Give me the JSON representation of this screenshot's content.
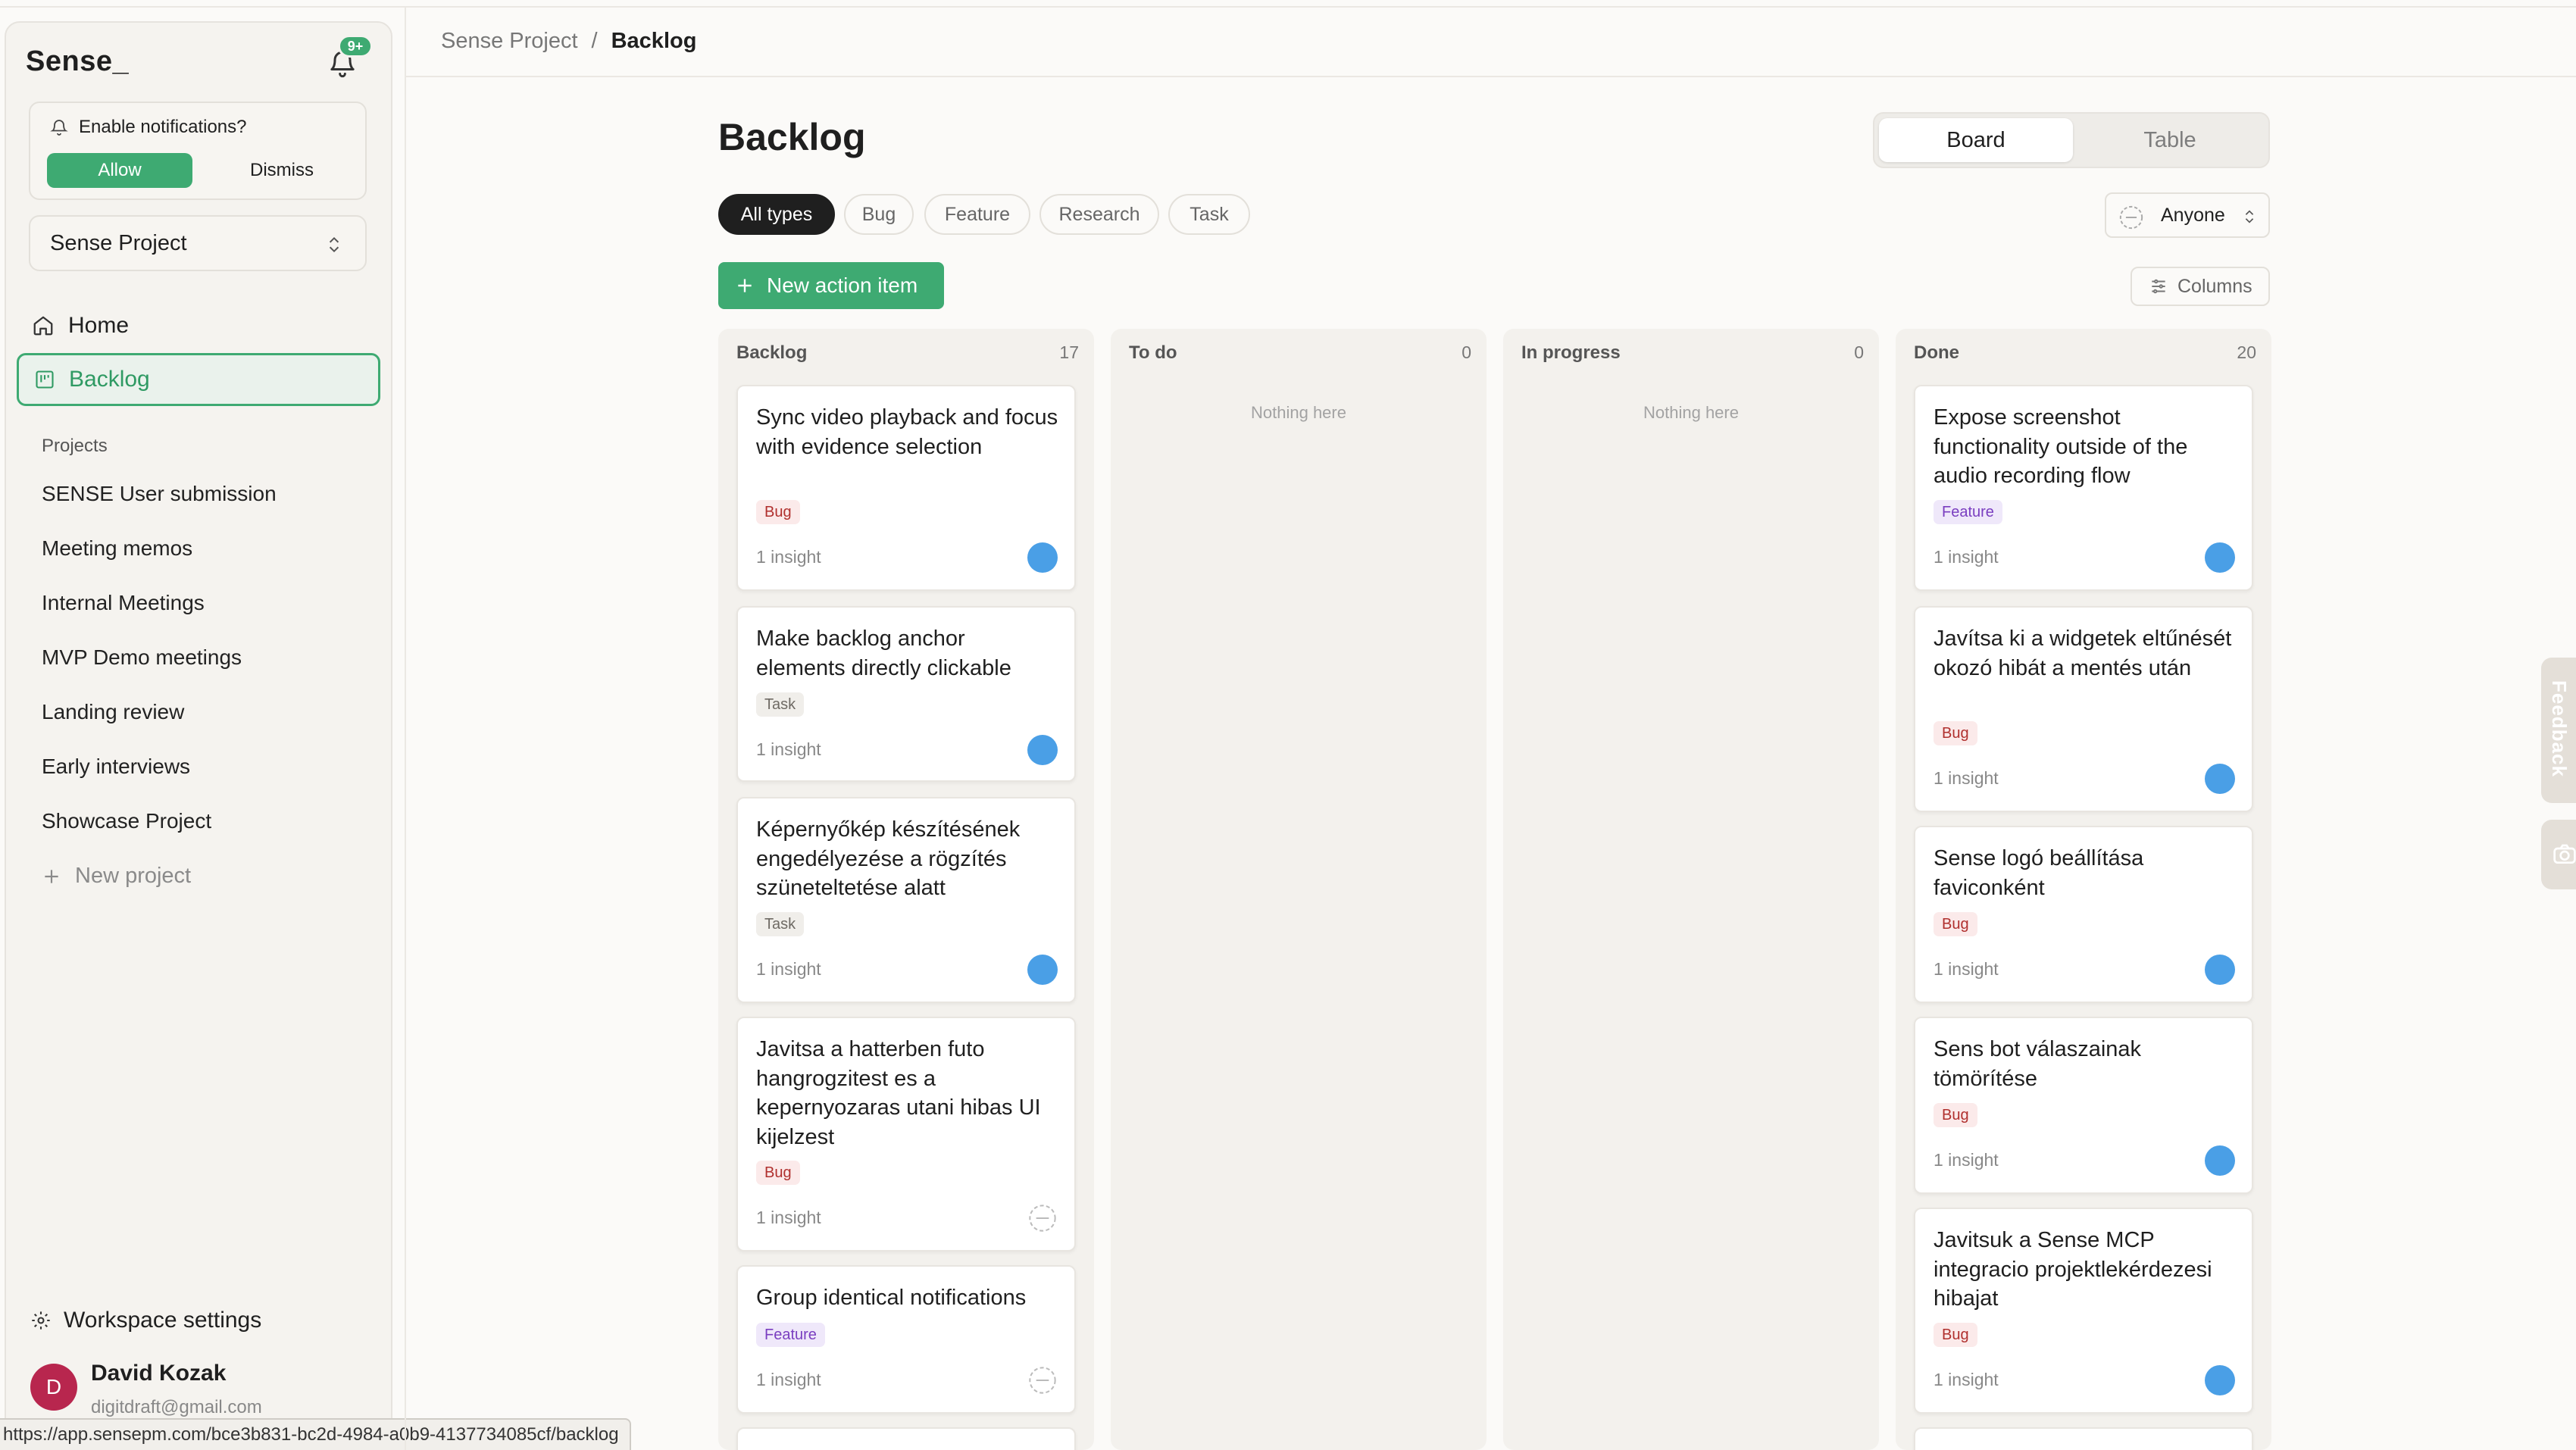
{
  "brand": "Sense_",
  "notifications": {
    "badge": "9+",
    "prompt": "Enable notifications?",
    "allow": "Allow",
    "dismiss": "Dismiss"
  },
  "project_selector": {
    "value": "Sense Project"
  },
  "nav": {
    "home": "Home",
    "backlog": "Backlog"
  },
  "projects": {
    "label": "Projects",
    "items": [
      "SENSE User submission",
      "Meeting memos",
      "Internal Meetings",
      "MVP Demo meetings",
      "Landing review",
      "Early interviews",
      "Showcase Project"
    ],
    "new_project": "New project"
  },
  "workspace_settings": "Workspace settings",
  "user": {
    "initial": "D",
    "name": "David Kozak",
    "email": "digitdraft@gmail.com"
  },
  "status_url": "https://app.sensepm.com/bce3b831-bc2d-4984-a0b9-4137734085cf/backlog",
  "breadcrumb": {
    "project": "Sense Project",
    "separator": "/",
    "current": "Backlog"
  },
  "page_title": "Backlog",
  "view_toggle": {
    "board": "Board",
    "table": "Table",
    "selected": "Board"
  },
  "type_filters": [
    "All types",
    "Bug",
    "Feature",
    "Research",
    "Task"
  ],
  "type_filter_selected": "All types",
  "assignee_filter": "Anyone",
  "new_action_item": "New action item",
  "columns_button": "Columns",
  "board": {
    "columns": [
      {
        "name": "Backlog",
        "count": "17",
        "cards": [
          {
            "title": "Sync video playback and focus with evidence selection",
            "tag": "Bug",
            "insights": "1 insight",
            "assigned": true
          },
          {
            "title": "Make backlog anchor elements directly clickable",
            "tag": "Task",
            "insights": "1 insight",
            "assigned": true
          },
          {
            "title": "Képernyőkép készítésének engedélyezése a rögzítés szüneteltetése alatt",
            "tag": "Task",
            "insights": "1 insight",
            "assigned": true
          },
          {
            "title": "Javitsa a hatterben futo hangrogzitest es a kepernyozaras utani hibas UI kijelzest",
            "tag": "Bug",
            "insights": "1 insight",
            "assigned": false
          },
          {
            "title": "Group identical notifications",
            "tag": "Feature",
            "insights": "1 insight",
            "assigned": false
          }
        ]
      },
      {
        "name": "To do",
        "count": "0",
        "empty": "Nothing here",
        "cards": []
      },
      {
        "name": "In progress",
        "count": "0",
        "empty": "Nothing here",
        "cards": []
      },
      {
        "name": "Done",
        "count": "20",
        "cards": [
          {
            "title": "Expose screenshot functionality outside of the audio recording flow",
            "tag": "Feature",
            "insights": "1 insight",
            "assigned": true
          },
          {
            "title": "Javítsa ki a widgetek eltűnését okozó hibát a mentés után",
            "tag": "Bug",
            "insights": "1 insight",
            "assigned": true
          },
          {
            "title": "Sense logó beállítása faviconként",
            "tag": "Bug",
            "insights": "1 insight",
            "assigned": true
          },
          {
            "title": "Sens bot válaszainak tömörítése",
            "tag": "Bug",
            "insights": "1 insight",
            "assigned": true
          },
          {
            "title": "Javitsuk a Sense MCP integracio projektlekérdezesi hibajat",
            "tag": "Bug",
            "insights": "1 insight",
            "assigned": true
          }
        ]
      }
    ]
  },
  "feedback_tab": "Feedback",
  "icons": [
    "bell-icon",
    "chevron-updown-icon",
    "home-icon",
    "backlog-icon",
    "plus-icon",
    "gear-icon",
    "columns-icon",
    "camera-icon"
  ],
  "colors": {
    "accent": "#3eaa72",
    "bug": "#b0302e",
    "feature": "#7a3ec0",
    "assignee": "#4a9fe6",
    "avatar": "#b8264e"
  }
}
